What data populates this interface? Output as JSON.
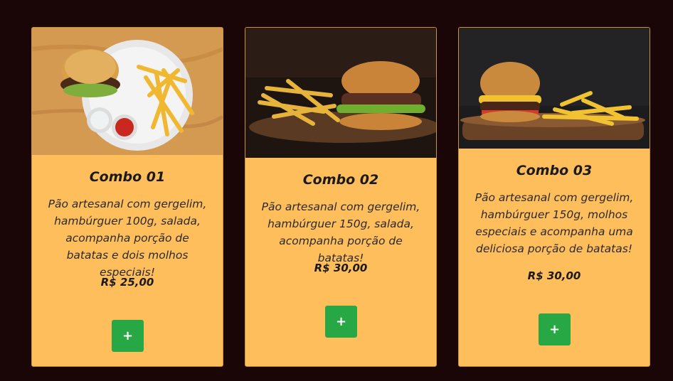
{
  "currency_note": "",
  "cards": [
    {
      "title": "Combo 01",
      "description": "Pão artesanal com gergelim, hambúrguer 100g, salada, acompanha porção de batatas e dois molhos especiais!",
      "price": "R$ 25,00",
      "button_label": "+"
    },
    {
      "title": "Combo 02",
      "description": "Pão artesanal com gergelim, hambúrguer 150g, salada, acompanha porção de batatas!",
      "price": "R$ 30,00",
      "button_label": "+"
    },
    {
      "title": "Combo 03",
      "description": "Pão artesanal com gergelim, hambúrguer 150g, molhos especiais e acompanha uma deliciosa porção de batatas!",
      "price": "R$ 30,00",
      "button_label": "+"
    }
  ],
  "colors": {
    "page_background": "#1a0606",
    "card_background": "#ffbe5c",
    "button_background": "#28a745"
  }
}
